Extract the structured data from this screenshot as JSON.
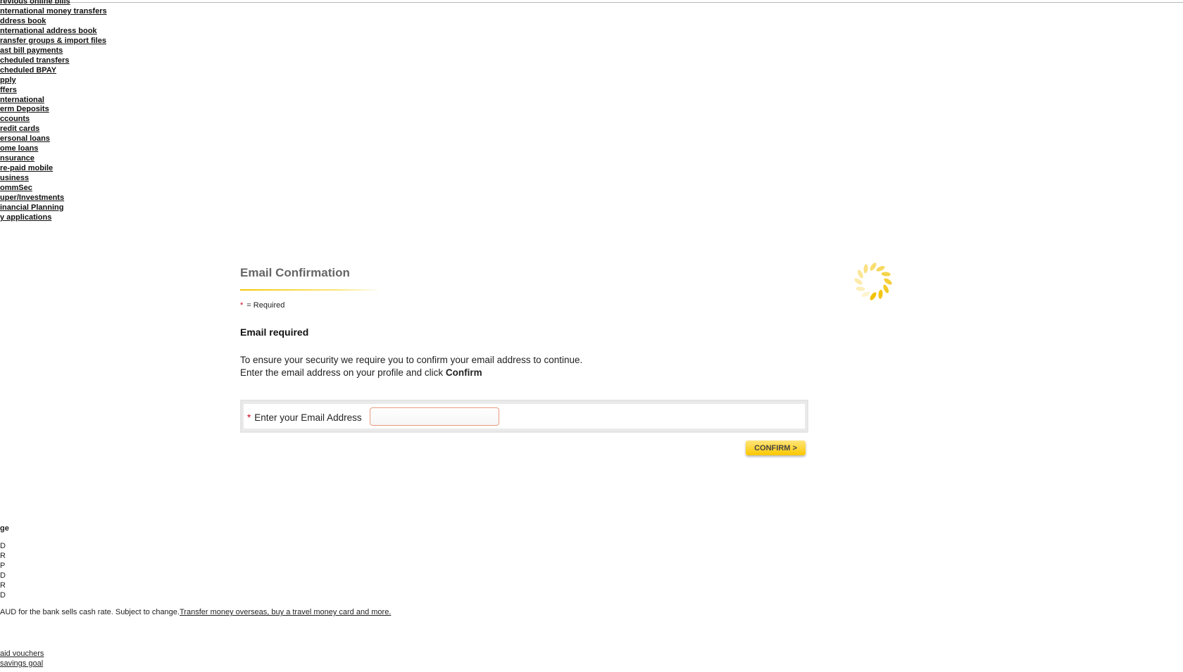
{
  "sidebar": {
    "items": [
      "revious online bills",
      "nternational money transfers",
      "ddress book",
      "nternational address book",
      "ransfer groups & import files",
      "ast bill payments",
      "cheduled transfers",
      "cheduled BPAY",
      "pply",
      "ffers",
      "nternational",
      "erm Deposits",
      "ccounts",
      "redit cards",
      "ersonal loans",
      "ome loans",
      "nsurance",
      "re-paid mobile",
      "usiness",
      "ommSec",
      "uper/Investments",
      "inancial Planning",
      "y applications"
    ]
  },
  "main": {
    "title": "Email Confirmation",
    "required_star": "*",
    "required_note": "= Required",
    "heading": "Email required",
    "para_line1": "To ensure your security we require you to confirm your email address to continue.",
    "para_line2": "Enter the email address on your profile and click ",
    "para_bold": "Confirm",
    "email_label": "Enter your Email Address",
    "email_value": "",
    "confirm_label": "CONFIRM >"
  },
  "footer": {
    "heading": "ge",
    "currencies": [
      "D",
      "R",
      "P",
      "D",
      "R",
      "D"
    ],
    "disclaimer": "AUD for the bank sells cash rate. Subject to change.",
    "disclaimer_link": "Transfer money overseas, buy a travel money card and more.",
    "links": [
      "aid vouchers",
      "savings goal"
    ]
  },
  "colors": {
    "accent": "#fcc800",
    "required": "#d0021b"
  },
  "icons": {
    "loading": "loading-spinner-icon"
  }
}
